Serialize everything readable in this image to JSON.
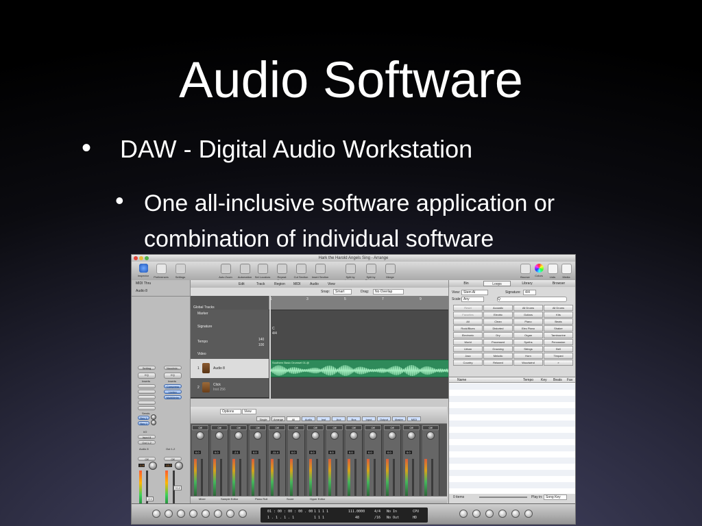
{
  "slide": {
    "title": "Audio Software",
    "bullet1": "DAW - Digital Audio Workstation",
    "bullet2": "One all-inclusive software application or combination of individual software",
    "bullet_glyph": "•"
  },
  "screenshot": {
    "window_title": "Hark the Harold Angels Sing - Arrange",
    "toolbar_left": [
      "Inspector",
      "Preferences",
      "Settings"
    ],
    "toolbar_mid": [
      "Auto Zoom",
      "Automation",
      "Set Locators",
      "Repeat Section",
      "Cut Section",
      "Insert Section",
      "Split by Locators",
      "Split by Playhead",
      "Merge"
    ],
    "toolbar_right": [
      "Bounce",
      "Colors",
      "Lists",
      "Media"
    ],
    "inspector": {
      "region1": "MIDI Thru",
      "region2": "Audio 8",
      "setting_left": "Setting",
      "setting_right": "Noodmix..",
      "eq": "EQ",
      "inserts": "Inserts",
      "plugins": [
        "Compress",
        "Limiter",
        "MultiMeter"
      ],
      "sends": "Sends",
      "sends_list": [
        "Bus 1",
        "Bus 2"
      ],
      "io": "I/O",
      "input": "Input 8",
      "output": "Out 1-2",
      "channel_left": "Audio 8",
      "channel_right": "Out 1-2",
      "mode": "Off",
      "left_db": "-1.9",
      "right_db": "-13.7",
      "left_vol": "-2.1",
      "right_vol": "+0.2",
      "read": "dB",
      "bnce": "Bnce"
    },
    "arrange": {
      "menus": [
        "Edit",
        "Track",
        "Region",
        "MIDI",
        "Audio",
        "View"
      ],
      "snap_label": "Snap:",
      "snap_value": "Smart",
      "drag_label": "Drag:",
      "drag_value": "No Overlap",
      "ruler_marks": [
        "1",
        "3",
        "5",
        "7",
        "9",
        "11",
        "13"
      ],
      "ruler_sub": [
        "1",
        "2",
        "3",
        "4",
        "5",
        "6",
        "7",
        "8",
        "9",
        "10",
        "11",
        "12",
        "13",
        "14"
      ],
      "global_tracks": "Global Tracks",
      "marker": "Marker",
      "signature": "Signature",
      "tempo": "Tempo",
      "tempo_values": [
        "140",
        "100"
      ],
      "video": "Video",
      "sig_c": "C",
      "sig_44": "4/4",
      "track1_num": "1",
      "track1_name": "Audio 8",
      "track2_num": "2",
      "track2_name": "Click",
      "track2_sub": "Inst 256",
      "region_name": "Southern Basic Drumset 01.@"
    },
    "mixer": {
      "tools": [
        "Options",
        "View"
      ],
      "filters": [
        "Single",
        "Arrange",
        "All",
        "Audio",
        "Inst",
        "Aux",
        "Bus",
        "Input",
        "Output",
        "Master",
        "MIDI"
      ],
      "channel_names": [
        "Off",
        "Off",
        "Off",
        "Off",
        "Off",
        "Off",
        "Off",
        "Off",
        "Off",
        "Off",
        "Off",
        "Off",
        "Off"
      ],
      "db_values": [
        "0.0",
        "0.0",
        "-2.1",
        "0.0",
        "-11.4",
        "0.0",
        "0.0",
        "0.0",
        "0.0",
        "0.0",
        "0.0",
        "0.0"
      ],
      "bottom_tabs": [
        "Mixer",
        "Sample Editor",
        "Piano Roll",
        "Score",
        "Hyper Editor"
      ]
    },
    "loops": {
      "tabs": [
        "Bin",
        "Loops",
        "Library",
        "Browser"
      ],
      "view_label": "View:",
      "view_value": "Stem Al",
      "signature_label": "Signature:",
      "signature_value": "4/4",
      "scale_label": "Scale:",
      "scale_value": "Any",
      "search_placeholder": "Q",
      "keywords": [
        "Reset",
        "Acoustic",
        "All Drums",
        "All Drums",
        "Favorites",
        "Electric",
        "Guitars",
        "Kits",
        "All",
        "Clean",
        "Piano",
        "Beats",
        "Rock/Blues",
        "Distorted",
        "Elec Piano",
        "Shaker",
        "Electronic",
        "Dry",
        "Organ",
        "Tambourine",
        "World",
        "Processed",
        "Synths",
        "Percussion",
        "Urban",
        "Grooving",
        "Strings",
        "Bell",
        "Jazz",
        "Melodic",
        "Horn",
        "Timpani",
        "Country",
        "Relaxed",
        "Woodwind",
        "»"
      ],
      "columns": [
        "Name",
        "Tempo",
        "Key",
        "Beats",
        "Fav"
      ],
      "footer_items": "0 items",
      "play_in": "Play in:",
      "play_in_value": "Song Key"
    },
    "transport": {
      "position": "1 . 1 . 1 . 1",
      "position2": "1 . 1 . 1 . 1",
      "smpte": "01 : 00 : 00 : 00 . 00",
      "bar": "1  1  1  1",
      "bar2": "1  1  1",
      "tempo": "111.0000",
      "tempo_sub": "48",
      "sig": "4/4",
      "sig_sub": "/16",
      "in": "No In",
      "out": "No Out",
      "cpu": "CPU",
      "hd": "HD"
    }
  }
}
